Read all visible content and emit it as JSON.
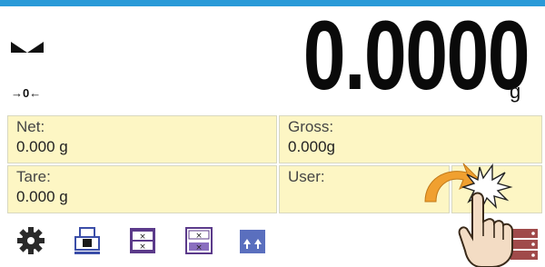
{
  "display": {
    "reading": "0.0000",
    "unit": "g",
    "zero_indicator": "→0←"
  },
  "info": {
    "net_label": "Net:",
    "net_value": "0.000 g",
    "gross_label": "Gross:",
    "gross_value": "0.000g",
    "tare_label": "Tare:",
    "tare_value": "0.000 g",
    "user_label": "User:",
    "user_value": ""
  },
  "toolbar": {
    "icons": [
      "gear-icon",
      "printer-icon",
      "packaging-icon",
      "packaging-alt-icon",
      "arrows-up-icon",
      "menu-icon"
    ]
  },
  "colors": {
    "accent": "#2a9ad8",
    "panel": "#fdf6c4",
    "icon_blue": "#5a6fbe",
    "icon_purple": "#5b3a8a",
    "hand_arrow": "#f0a030"
  }
}
